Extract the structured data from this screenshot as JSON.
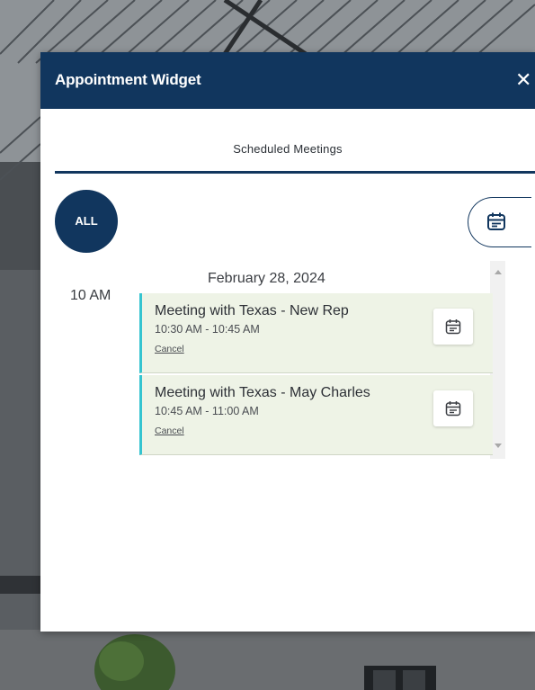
{
  "widget": {
    "title": "Appointment Widget",
    "close_icon": "close-icon",
    "tab_label": "Scheduled Meetings",
    "all_button": "ALL",
    "calendar_icon": "calendar-icon"
  },
  "schedule": {
    "date": "February 28, 2024",
    "hour_label": "10 AM",
    "meetings": [
      {
        "title": "Meeting with Texas - New Rep",
        "time": "10:30 AM - 10:45 AM",
        "cancel_label": "Cancel",
        "icon": "calendar-icon"
      },
      {
        "title": "Meeting with Texas - May Charles",
        "time": "10:45 AM - 11:00 AM",
        "cancel_label": "Cancel",
        "icon": "calendar-icon"
      }
    ]
  },
  "colors": {
    "header_bg": "#11365e",
    "meeting_bg": "#eef3e6",
    "meeting_accent": "#35c4d0"
  }
}
